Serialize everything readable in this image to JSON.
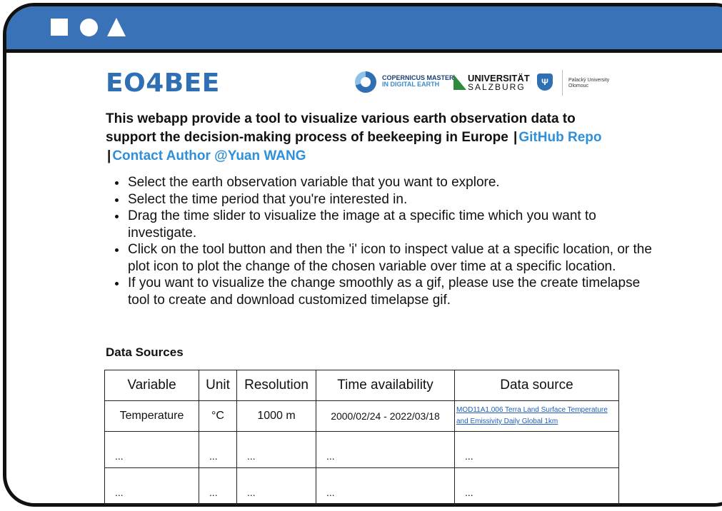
{
  "window": {
    "titlebar_color": "#3a72b8",
    "controls": [
      "square-shape",
      "circle-shape",
      "triangle-shape"
    ]
  },
  "app": {
    "title": "EO4BEE",
    "title_color": "#2f6fb4",
    "description_text": "This webapp provide a tool to visualize various earth observation data to support the decision-making process of beekeeping in Europe",
    "separator": "|",
    "github_link": "GitHub Repo",
    "contact_link": "Contact Author @Yuan WANG",
    "link_color": "#2f8fd8"
  },
  "logos": {
    "copernicus_line1": "COPERNICUS MASTER",
    "copernicus_line2": "IN DIGITAL EARTH",
    "salzburg_line1": "UNIVERSITÄT",
    "salzburg_line2": "SALZBURG",
    "palacky_line1": "Palacký University",
    "palacky_line2": "Olomouc"
  },
  "instructions": [
    "Select the earth observation variable that you want to explore.",
    "Select the time period that you're interested in.",
    "Drag the time slider to visualize the image at a specific time which you want to investigate.",
    "Click on the tool button and then the 'i' icon to inspect value at a specific location, or the plot icon to plot the change of the chosen variable over time at a specific location.",
    "If you want to visualize the change smoothly as a gif, please use the create timelapse tool to create and download customized timelapse gif."
  ],
  "data_sources": {
    "heading": "Data Sources",
    "columns": [
      "Variable",
      "Unit",
      "Resolution",
      "Time availability",
      "Data source"
    ],
    "rows": [
      [
        "Temperature",
        "°C",
        "1000 m",
        "2000/02/24 - 2022/03/18",
        "MOD11A1.006 Terra Land Surface Temperature and Emissivity Daily Global 1km"
      ],
      [
        "...",
        "...",
        "...",
        "...",
        "..."
      ],
      [
        "...",
        "...",
        "...",
        "...",
        "..."
      ]
    ]
  }
}
